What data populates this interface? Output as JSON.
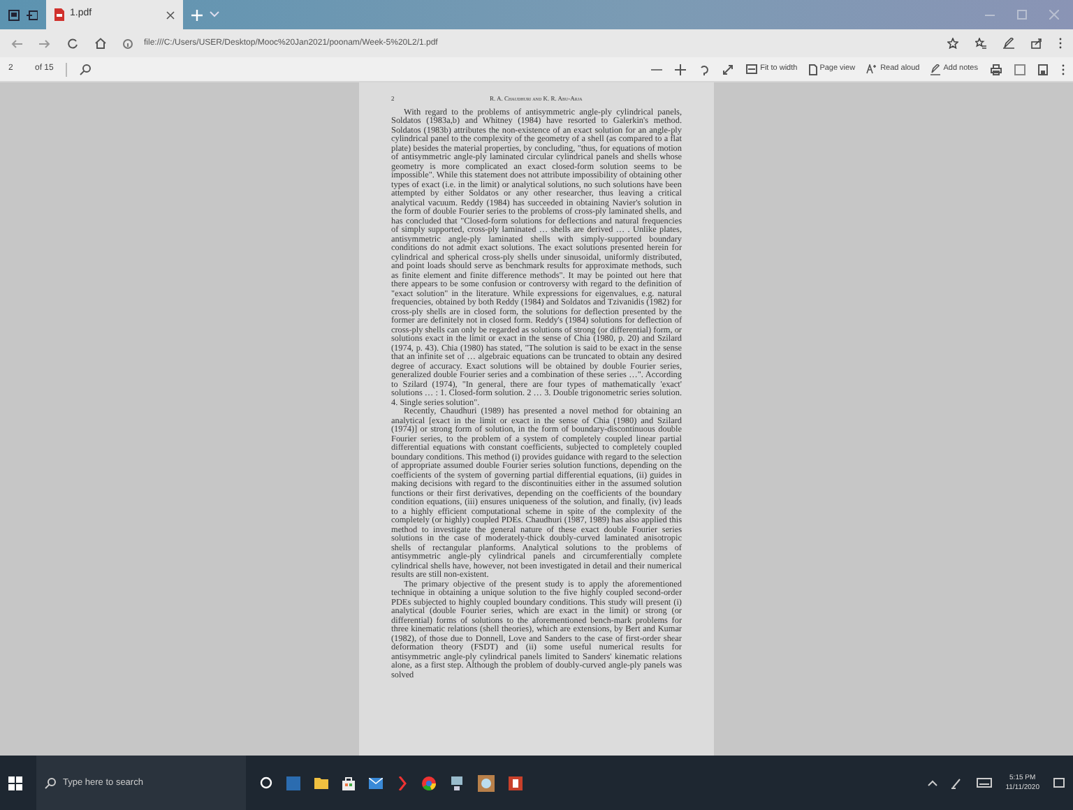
{
  "browser": {
    "tab": {
      "title": "1.pdf",
      "selected": true
    },
    "address": "file:///C:/Users/USER/Desktop/Mooc%20Jan2021/poonam/Week-5%20L2/1.pdf"
  },
  "pdf_toolbar": {
    "page_number": "2",
    "page_count": "of 15",
    "buttons": [
      {
        "kind": "fit",
        "label": "Fit to width"
      },
      {
        "kind": "page",
        "label": "Page view"
      },
      {
        "kind": "read",
        "label": "Read aloud"
      },
      {
        "kind": "notes",
        "label": "Add notes"
      }
    ]
  },
  "document": {
    "page_number": "2",
    "running_head": "R. A. Chaudhuri and K. R. Abu-Arja",
    "paragraphs": [
      "With regard to the problems of antisymmetric angle-ply cylindrical panels, Soldatos (1983a,b) and Whitney (1984) have resorted to Galerkin's method. Soldatos (1983b) attributes the non-existence of an exact solution for an angle-ply cylindrical panel to the complexity of the geometry of a shell (as compared to a flat plate) besides the material properties, by concluding, \"thus, for equations of motion of antisymmetric angle-ply laminated circular cylindrical panels and shells whose geometry is more complicated an exact closed-form solution seems to be impossible\". While this statement does not attribute impossibility of obtaining other types of exact (i.e. in the limit) or analytical solutions, no such solutions have been attempted by either Soldatos or any other researcher, thus leaving a critical analytical vacuum. Reddy (1984) has succeeded in obtaining Navier's solution in the form of double Fourier series to the problems of cross-ply laminated shells, and has concluded that \"Closed-form solutions for deflections and natural frequencies of simply supported, cross-ply laminated … shells are derived … . Unlike plates, antisymmetric angle-ply laminated shells with simply-supported boundary conditions do not admit exact solutions. The exact solutions presented herein for cylindrical and spherical cross-ply shells under sinusoidal, uniformly distributed, and point loads should serve as benchmark results for approximate methods, such as finite element and finite difference methods\". It may be pointed out here that there appears to be some confusion or controversy with regard to the definition of \"exact solution\" in the literature. While expressions for eigenvalues, e.g. natural frequencies, obtained by both Reddy (1984) and Soldatos and Tzivanidis (1982) for cross-ply shells are in closed form, the solutions for deflection presented by the former are definitely not in closed form. Reddy's (1984) solutions for deflection of cross-ply shells can only be regarded as solutions of strong (or differential) form, or solutions exact in the limit or exact in the sense of Chia (1980, p. 20) and Szilard (1974, p. 43). Chia (1980) has stated, \"The solution is said to be exact in the sense that an infinite set of … algebraic equations can be truncated to obtain any desired degree of accuracy. Exact solutions will be obtained by double Fourier series, generalized double Fourier series and a combination of these series …\". According to Szilard (1974), \"In general, there are four types of mathematically 'exact' solutions … : 1. Closed-form solution. 2 … 3. Double trigonometric series solution. 4. Single series solution\".",
      "Recently, Chaudhuri (1989) has presented a novel method for obtaining an analytical [exact in the limit or exact in the sense of Chia (1980) and Szilard (1974)] or strong form of solution, in the form of boundary-discontinuous double Fourier series, to the problem of a system of completely coupled linear partial differential equations with constant coefficients, subjected to completely coupled boundary conditions. This method (i) provides guidance with regard to the selection of appropriate assumed double Fourier series solution functions, depending on the coefficients of the system of governing partial differential equations, (ii) guides in making decisions with regard to the discontinuities either in the assumed solution functions or their first derivatives, depending on the coefficients of the boundary condition equations, (iii) ensures uniqueness of the solution, and finally, (iv) leads to a highly efficient computational scheme in spite of the complexity of the completely (or highly) coupled PDEs. Chaudhuri (1987, 1989) has also applied this method to investigate the general nature of these exact double Fourier series solutions in the case of moderately-thick doubly-curved laminated anisotropic shells of rectangular planforms. Analytical solutions to the problems of antisymmetric angle-ply cylindrical panels and circumferentially complete cylindrical shells have, however, not been investigated in detail and their numerical results are still non-existent.",
      "The primary objective of the present study is to apply the aforementioned technique in obtaining a unique solution to the five highly coupled second-order PDEs subjected to highly coupled boundary conditions. This study will present (i) analytical (double Fourier series, which are exact in the limit) or strong (or differential) forms of solutions to the aforementioned bench-mark problems for three kinematic relations (shell theories), which are extensions, by Bert and Kumar (1982), of those due to Donnell, Love and Sanders to the case of first-order shear deformation theory (FSDT) and (ii) some useful numerical results for antisymmetric angle-ply cylindrical panels limited to Sanders' kinematic relations alone, as a first step. Although the problem of doubly-curved angle-ply panels was solved"
    ]
  },
  "taskbar": {
    "search_placeholder": "Type here to search",
    "time": "5:15 PM",
    "date": "11/11/2020"
  }
}
